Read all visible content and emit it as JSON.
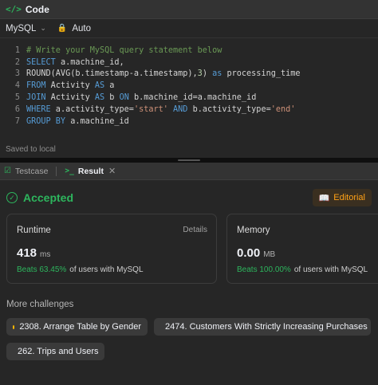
{
  "code_panel": {
    "title": "Code",
    "language": "MySQL",
    "mode": "Auto",
    "saved_status": "Saved to local",
    "lines": [
      {
        "num": "1",
        "html": "<span class=\"cm\"># Write your MySQL query statement below</span>"
      },
      {
        "num": "2",
        "html": "<span class=\"kw\">SELECT</span> a.machine_id,"
      },
      {
        "num": "3",
        "html": "ROUND(AVG(b.timestamp-a.timestamp),<span class=\"num\">3</span>) <span class=\"kw\">as</span> processing_time"
      },
      {
        "num": "4",
        "html": "<span class=\"kw\">FROM</span> Activity <span class=\"kw\">AS</span> a"
      },
      {
        "num": "5",
        "html": "<span class=\"kw\">JOIN</span> Activity <span class=\"kw\">AS</span> b <span class=\"kw\">ON</span> b.machine_id=a.machine_id"
      },
      {
        "num": "6",
        "html": "<span class=\"kw\">WHERE</span> a.activity_type=<span class=\"str\">'start'</span> <span class=\"kw\">AND</span> b.activity_type=<span class=\"str\">'end'</span>"
      },
      {
        "num": "7",
        "html": "<span class=\"kw\">GROUP BY</span> a.machine_id"
      }
    ]
  },
  "result_panel": {
    "tabs": [
      {
        "label": "Testcase",
        "active": false
      },
      {
        "label": "Result",
        "active": true
      }
    ],
    "status": "Accepted",
    "editorial_label": "Editorial",
    "runtime": {
      "title": "Runtime",
      "details_label": "Details",
      "value": "418",
      "unit": "ms",
      "beats_pct": "Beats 63.45%",
      "beats_text": "of users with MySQL"
    },
    "memory": {
      "title": "Memory",
      "value": "0.00",
      "unit": "MB",
      "beats_pct": "Beats 100.00%",
      "beats_text": "of users with MySQL"
    },
    "more_title": "More challenges",
    "challenges": [
      {
        "label": "2308. Arrange Table by Gender",
        "difficulty_color": "#ffb800"
      },
      {
        "label": "2474. Customers With Strictly Increasing Purchases",
        "difficulty_color": "#f63737"
      },
      {
        "label": "262. Trips and Users",
        "difficulty_color": "#f63737"
      }
    ]
  },
  "colors": {
    "accent_green": "#2db55d",
    "accent_orange": "#ffa116"
  }
}
